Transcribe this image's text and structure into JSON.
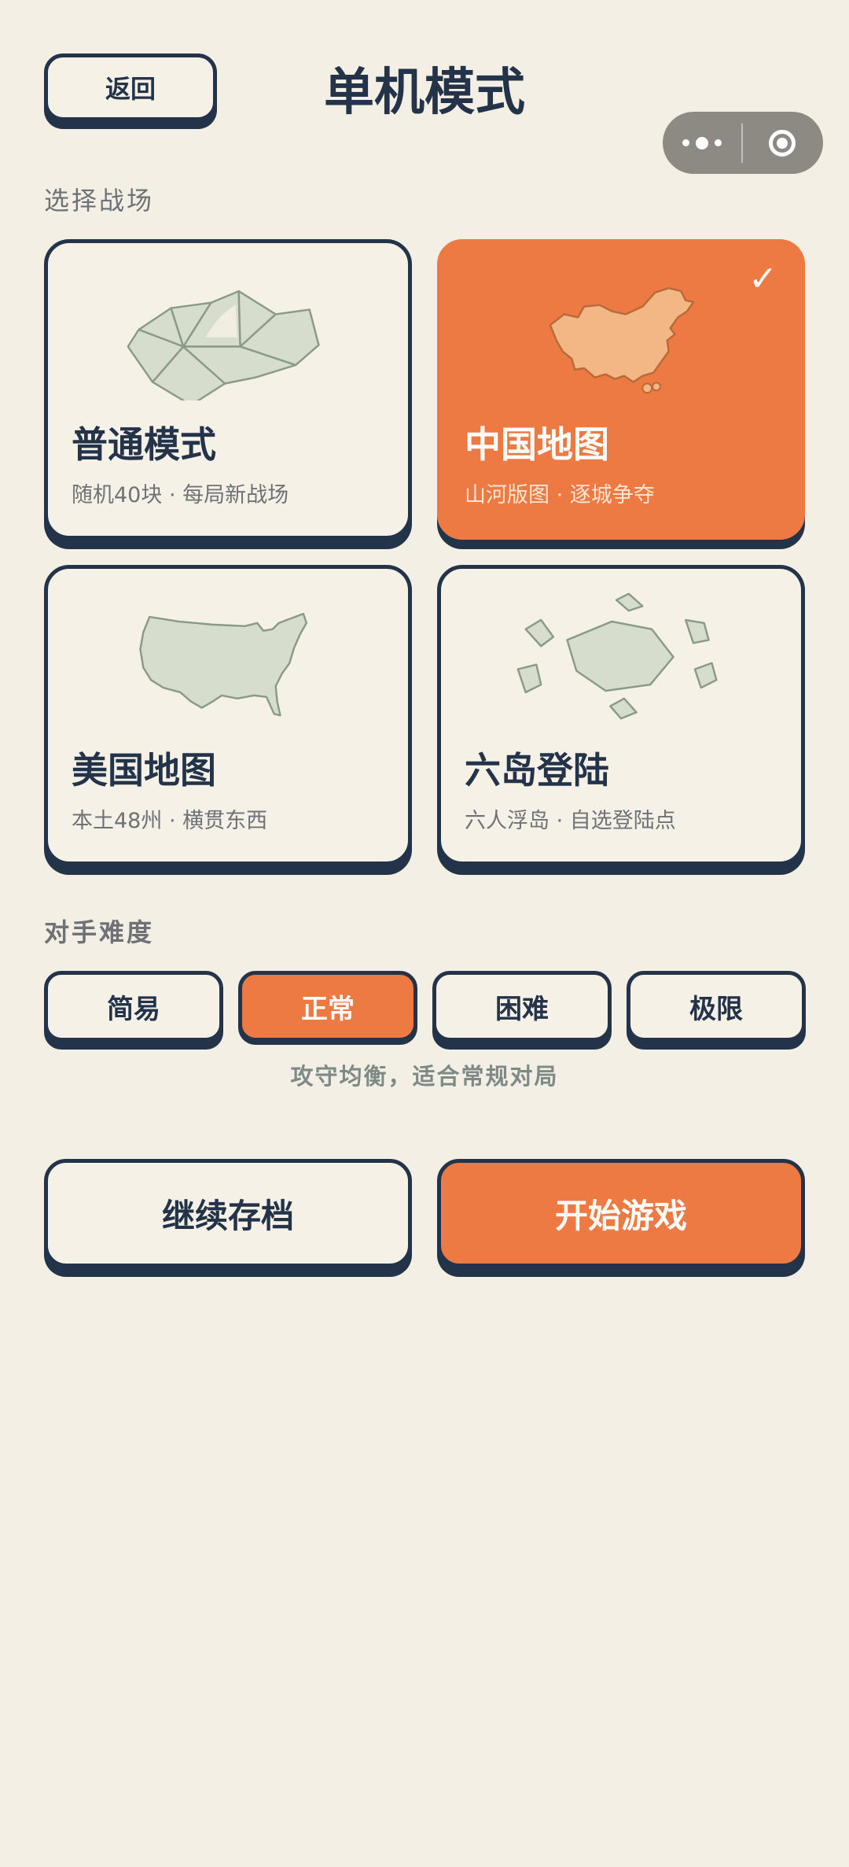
{
  "header": {
    "back_label": "返回",
    "title": "单机模式"
  },
  "capsule": {
    "more_icon": "more-dots-icon",
    "close_icon": "target-circle-icon"
  },
  "battlefield": {
    "section_label": "选择战场",
    "cards": [
      {
        "title": "普通模式",
        "subtitle": "随机40块 · 每局新战场",
        "icon": "polygon-map-icon",
        "selected": false
      },
      {
        "title": "中国地图",
        "subtitle": "山河版图 · 逐城争夺",
        "icon": "china-map-icon",
        "selected": true,
        "check": "✓"
      },
      {
        "title": "美国地图",
        "subtitle": "本土48州 · 横贯东西",
        "icon": "usa-map-icon",
        "selected": false
      },
      {
        "title": "六岛登陆",
        "subtitle": "六人浮岛 · 自选登陆点",
        "icon": "islands-icon",
        "selected": false
      }
    ]
  },
  "difficulty": {
    "section_label": "对手难度",
    "options": [
      "简易",
      "正常",
      "困难",
      "极限"
    ],
    "selected": "正常",
    "description": "攻守均衡，适合常规对局"
  },
  "actions": {
    "continue_label": "继续存档",
    "start_label": "开始游戏"
  },
  "colors": {
    "background": "#f3efe4",
    "accent": "#ec7a42",
    "ink": "#23334a",
    "card": "#f6f1e6",
    "map_fill": "#d7ddcd",
    "map_stroke": "#8a9a88"
  }
}
